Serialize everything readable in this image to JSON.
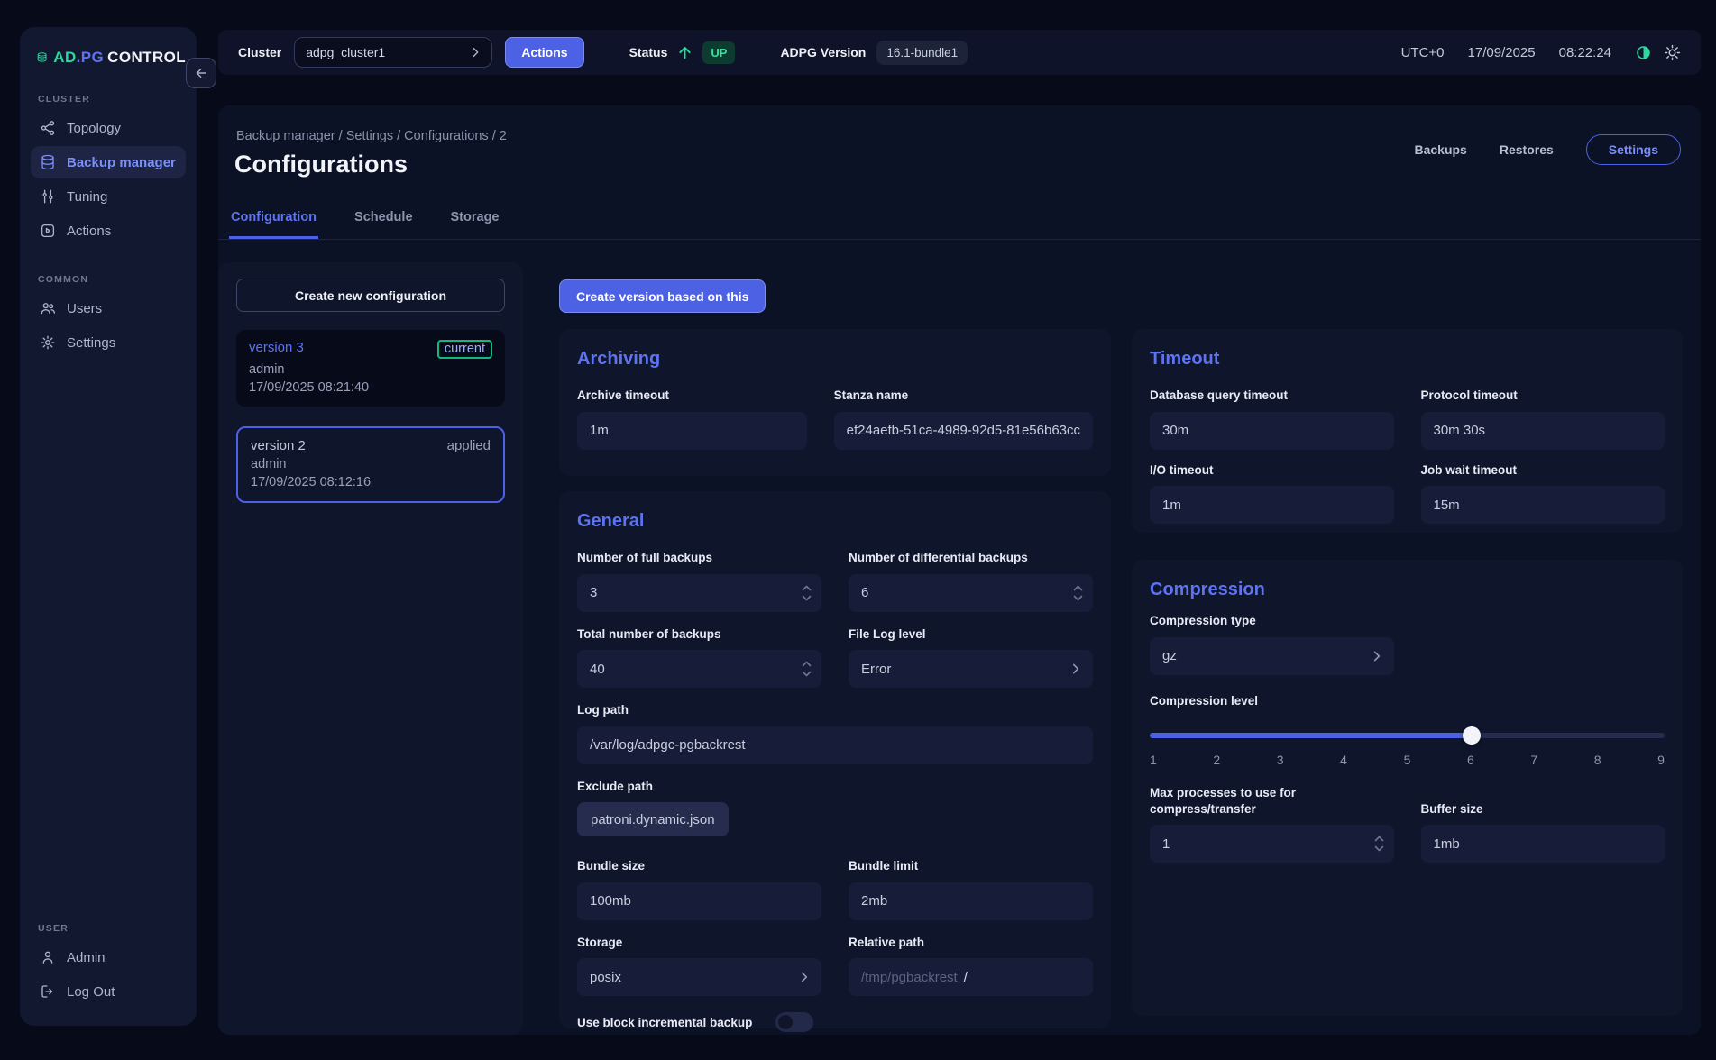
{
  "topbar": {
    "cluster_label": "Cluster",
    "cluster_value": "adpg_cluster1",
    "actions_button": "Actions",
    "status_label": "Status",
    "status_value": "UP",
    "version_label": "ADPG Version",
    "version_value": "16.1-bundle1",
    "timezone": "UTC+0",
    "date": "17/09/2025",
    "time": "08:22:24"
  },
  "sidebar": {
    "logo_ad": "AD",
    "logo_pg": ".PG",
    "logo_control": "CONTROL",
    "sections": {
      "cluster": "CLUSTER",
      "common": "COMMON",
      "user": "USER"
    },
    "nav": {
      "topology": "Topology",
      "backup_manager": "Backup manager",
      "tuning": "Tuning",
      "actions": "Actions",
      "users": "Users",
      "settings": "Settings",
      "admin": "Admin",
      "logout": "Log Out"
    }
  },
  "page": {
    "breadcrumb": "Backup manager / Settings / Configurations / 2",
    "title": "Configurations",
    "actions": {
      "backups": "Backups",
      "restores": "Restores",
      "settings": "Settings"
    },
    "tabs": {
      "configuration": "Configuration",
      "schedule": "Schedule",
      "storage": "Storage"
    }
  },
  "versions": {
    "create_button": "Create new configuration",
    "items": [
      {
        "name": "version 3",
        "badge": "current",
        "author": "admin",
        "datetime": "17/09/2025 08:21:40"
      },
      {
        "name": "version 2",
        "badge": "applied",
        "author": "admin",
        "datetime": "17/09/2025 08:12:16"
      }
    ]
  },
  "content": {
    "create_version_button": "Create version based on this",
    "archiving": {
      "title": "Archiving",
      "archive_timeout": {
        "label": "Archive timeout",
        "value": "1m"
      },
      "stanza_name": {
        "label": "Stanza name",
        "value": "ef24aefb-51ca-4989-92d5-81e56b63cc"
      }
    },
    "general": {
      "title": "General",
      "full_backups": {
        "label": "Number of full backups",
        "value": "3"
      },
      "diff_backups": {
        "label": "Number of differential backups",
        "value": "6"
      },
      "total_backups": {
        "label": "Total number of backups",
        "value": "40"
      },
      "file_log_level": {
        "label": "File Log level",
        "value": "Error"
      },
      "log_path": {
        "label": "Log path",
        "value": "/var/log/adpgc-pgbackrest"
      },
      "exclude_path": {
        "label": "Exclude path",
        "value": "patroni.dynamic.json"
      },
      "bundle_size": {
        "label": "Bundle size",
        "value": "100mb"
      },
      "bundle_limit": {
        "label": "Bundle limit",
        "value": "2mb"
      },
      "storage": {
        "label": "Storage",
        "value": "posix"
      },
      "relative_path": {
        "label": "Relative path",
        "placeholder": "/tmp/pgbackrest",
        "value": "/"
      },
      "block_incremental": {
        "label": "Use block incremental backup",
        "enabled": false
      }
    },
    "timeout": {
      "title": "Timeout",
      "db_query": {
        "label": "Database query timeout",
        "value": "30m"
      },
      "protocol": {
        "label": "Protocol timeout",
        "value": "30m 30s"
      },
      "io": {
        "label": "I/O timeout",
        "value": "1m"
      },
      "job_wait": {
        "label": "Job wait timeout",
        "value": "15m"
      }
    },
    "compression": {
      "title": "Compression",
      "type": {
        "label": "Compression type",
        "value": "gz"
      },
      "level": {
        "label": "Compression level",
        "value": 6,
        "min": 1,
        "max": 9,
        "ticks": [
          "1",
          "2",
          "3",
          "4",
          "5",
          "6",
          "7",
          "8",
          "9"
        ]
      },
      "max_processes": {
        "label": "Max processes to use for compress/transfer",
        "value": "1"
      },
      "buffer_size": {
        "label": "Buffer size",
        "value": "1mb"
      }
    }
  },
  "colors": {
    "accent_blue": "#4c61e4",
    "link_blue": "#5d73f2",
    "brand_green": "#2bd99f",
    "current_badge_border": "#14b87e",
    "status_up_bg": "#0d3b2f",
    "status_up_text": "#35e0a1"
  }
}
